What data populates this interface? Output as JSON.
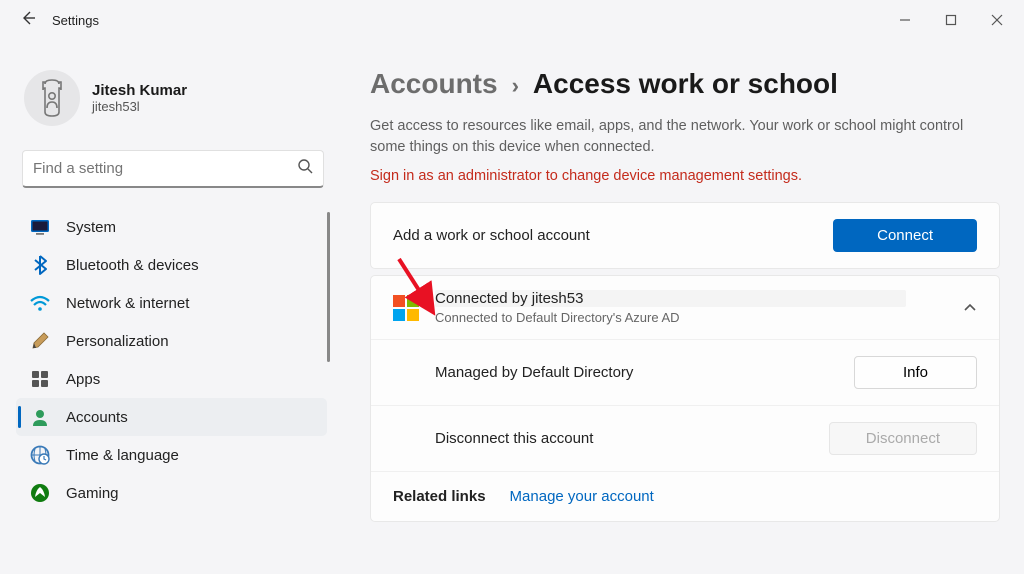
{
  "window": {
    "title": "Settings"
  },
  "profile": {
    "name": "Jitesh Kumar",
    "sub": "jitesh53l"
  },
  "search": {
    "placeholder": "Find a setting"
  },
  "sidebar": {
    "items": [
      {
        "label": "System",
        "icon": "system"
      },
      {
        "label": "Bluetooth & devices",
        "icon": "bluetooth"
      },
      {
        "label": "Network & internet",
        "icon": "network"
      },
      {
        "label": "Personalization",
        "icon": "personalization"
      },
      {
        "label": "Apps",
        "icon": "apps"
      },
      {
        "label": "Accounts",
        "icon": "accounts",
        "selected": true
      },
      {
        "label": "Time & language",
        "icon": "time"
      },
      {
        "label": "Gaming",
        "icon": "gaming"
      }
    ]
  },
  "breadcrumb": {
    "parent": "Accounts",
    "current": "Access work or school"
  },
  "description": "Get access to resources like email, apps, and the network. Your work or school might control some things on this device when connected.",
  "admin_warning": "Sign in as an administrator to change device management settings.",
  "add_account": {
    "label": "Add a work or school account",
    "button": "Connect"
  },
  "connected_account": {
    "title": "Connected by jitesh53",
    "subtitle": "Connected to Default Directory's Azure AD",
    "managed_label": "Managed by Default Directory",
    "info_button": "Info",
    "disconnect_label": "Disconnect this account",
    "disconnect_button": "Disconnect"
  },
  "related": {
    "label": "Related links",
    "link": "Manage your account"
  }
}
